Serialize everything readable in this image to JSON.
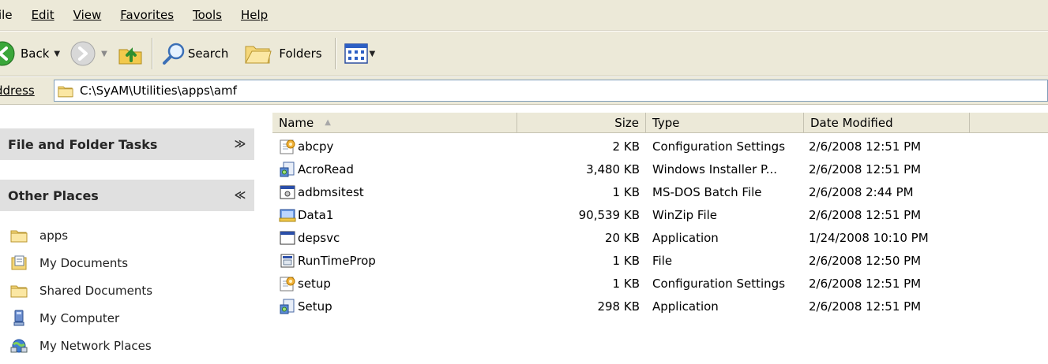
{
  "menubar": {
    "items": [
      {
        "label": "ile"
      },
      {
        "label": "Edit"
      },
      {
        "label": "View"
      },
      {
        "label": "Favorites"
      },
      {
        "label": "Tools"
      },
      {
        "label": "Help"
      }
    ]
  },
  "toolbar": {
    "back_label": "Back",
    "search_label": "Search",
    "folders_label": "Folders"
  },
  "address": {
    "label": "ddress",
    "path": "C:\\SyAM\\Utilities\\apps\\amf"
  },
  "taskpane": {
    "file_folder_tasks": "File and Folder Tasks",
    "other_places": "Other Places",
    "places": [
      {
        "label": "apps",
        "icon": "folder-icon"
      },
      {
        "label": "My Documents",
        "icon": "my-documents-icon"
      },
      {
        "label": "Shared Documents",
        "icon": "folder-icon"
      },
      {
        "label": "My Computer",
        "icon": "my-computer-icon"
      },
      {
        "label": "My Network Places",
        "icon": "network-places-icon"
      }
    ]
  },
  "filelist": {
    "columns": {
      "name": "Name",
      "size": "Size",
      "type": "Type",
      "date": "Date Modified"
    },
    "rows": [
      {
        "name": "abcpy",
        "size": "2 KB",
        "type": "Configuration Settings",
        "date": "2/6/2008 12:51 PM",
        "icon": "config-settings-icon"
      },
      {
        "name": "AcroRead",
        "size": "3,480 KB",
        "type": "Windows Installer P...",
        "date": "2/6/2008 12:51 PM",
        "icon": "installer-icon"
      },
      {
        "name": "adbmsitest",
        "size": "1 KB",
        "type": "MS-DOS Batch File",
        "date": "2/6/2008 2:44 PM",
        "icon": "batch-file-icon"
      },
      {
        "name": "Data1",
        "size": "90,539 KB",
        "type": "WinZip File",
        "date": "2/6/2008 12:51 PM",
        "icon": "winzip-icon"
      },
      {
        "name": "depsvc",
        "size": "20 KB",
        "type": "Application",
        "date": "1/24/2008 10:10 PM",
        "icon": "application-icon"
      },
      {
        "name": "RunTimeProp",
        "size": "1 KB",
        "type": "File",
        "date": "2/6/2008 12:50 PM",
        "icon": "generic-file-icon"
      },
      {
        "name": "setup",
        "size": "1 KB",
        "type": "Configuration Settings",
        "date": "2/6/2008 12:51 PM",
        "icon": "config-settings-icon"
      },
      {
        "name": "Setup",
        "size": "298 KB",
        "type": "Application",
        "date": "2/6/2008 12:51 PM",
        "icon": "installer-icon"
      }
    ]
  },
  "colors": {
    "chrome": "#ece9d8",
    "pane_header": "#e0e0e0",
    "address_border": "#7f9db9"
  }
}
